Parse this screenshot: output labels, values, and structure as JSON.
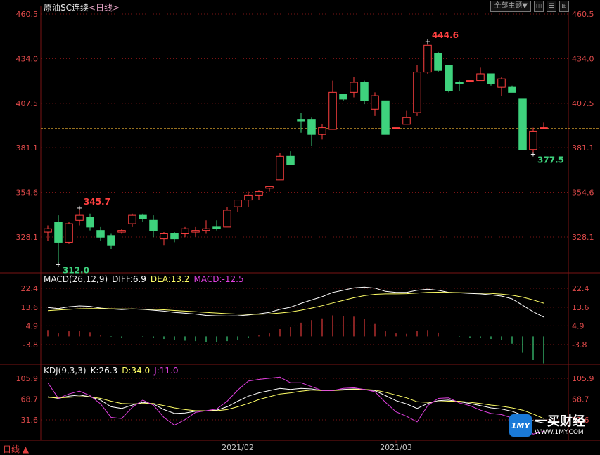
{
  "header": {
    "title": "原油SC连续",
    "period": "<日线>"
  },
  "toolbar": {
    "theme_label": "全部主题▼",
    "btn1": "◫",
    "btn2": "☰",
    "btn3": "⊞"
  },
  "period_tab": {
    "label": "日线",
    "arrow": "▲"
  },
  "watermark": {
    "logo": "1MY",
    "name": "一买财经",
    "url": "WWW.1MY.COM"
  },
  "colors": {
    "up": "#ff4040",
    "down": "#3ed27d",
    "grid": "#7a1414",
    "dashed": "#c8962a",
    "axis_text": "#e04a4a",
    "macd_pos": "#e03a3a",
    "macd_neg": "#3ed27d",
    "diff": "#ffffff",
    "dea": "#ffff66",
    "macd": "#e040e0",
    "k": "#ffffff",
    "d": "#ffff66",
    "j": "#e040e0"
  },
  "chart_data": [
    {
      "type": "candlestick",
      "title": "原油SC连续 日线",
      "y_ticks": [
        "460.5",
        "434.0",
        "407.5",
        "381.1",
        "354.6",
        "328.1"
      ],
      "ylim": [
        302,
        464
      ],
      "reference_line": 392.5,
      "x_labels": [
        "2021/02",
        "2021/03"
      ],
      "annotations": [
        {
          "text": "345.7",
          "value": 345.7,
          "kind": "high"
        },
        {
          "text": "312.0",
          "value": 312.0,
          "kind": "low"
        },
        {
          "text": "444.6",
          "value": 444.6,
          "kind": "high"
        },
        {
          "text": "377.5",
          "value": 377.5,
          "kind": "low"
        }
      ],
      "candles": [
        {
          "o": 331,
          "h": 335,
          "l": 326,
          "c": 333
        },
        {
          "o": 337,
          "h": 341,
          "l": 312,
          "c": 325
        },
        {
          "o": 325,
          "h": 337,
          "l": 324,
          "c": 336
        },
        {
          "o": 338,
          "h": 345.7,
          "l": 335,
          "c": 341
        },
        {
          "o": 340,
          "h": 342,
          "l": 332,
          "c": 334
        },
        {
          "o": 332,
          "h": 334,
          "l": 326,
          "c": 328
        },
        {
          "o": 329,
          "h": 330,
          "l": 321,
          "c": 323
        },
        {
          "o": 331,
          "h": 333,
          "l": 330,
          "c": 332
        },
        {
          "o": 336,
          "h": 342,
          "l": 334,
          "c": 341
        },
        {
          "o": 341,
          "h": 342,
          "l": 337,
          "c": 339
        },
        {
          "o": 338,
          "h": 341,
          "l": 328,
          "c": 332
        },
        {
          "o": 327,
          "h": 331,
          "l": 323,
          "c": 330
        },
        {
          "o": 330,
          "h": 331,
          "l": 325,
          "c": 327
        },
        {
          "o": 330,
          "h": 334,
          "l": 328,
          "c": 333
        },
        {
          "o": 331,
          "h": 334,
          "l": 328,
          "c": 332
        },
        {
          "o": 332,
          "h": 338,
          "l": 330,
          "c": 333
        },
        {
          "o": 334,
          "h": 338,
          "l": 332,
          "c": 333
        },
        {
          "o": 334,
          "h": 346,
          "l": 334,
          "c": 344
        },
        {
          "o": 346,
          "h": 350,
          "l": 343,
          "c": 350
        },
        {
          "o": 350,
          "h": 355,
          "l": 346,
          "c": 353
        },
        {
          "o": 353,
          "h": 356,
          "l": 350,
          "c": 355
        },
        {
          "o": 357,
          "h": 358,
          "l": 355,
          "c": 358
        },
        {
          "o": 362,
          "h": 378,
          "l": 362,
          "c": 376
        },
        {
          "o": 376,
          "h": 379,
          "l": 371,
          "c": 371
        },
        {
          "o": 398,
          "h": 402,
          "l": 390,
          "c": 397
        },
        {
          "o": 398,
          "h": 399,
          "l": 382,
          "c": 389
        },
        {
          "o": 389,
          "h": 395,
          "l": 386,
          "c": 393
        },
        {
          "o": 392,
          "h": 421,
          "l": 392,
          "c": 414
        },
        {
          "o": 413,
          "h": 413,
          "l": 409,
          "c": 410
        },
        {
          "o": 414,
          "h": 423,
          "l": 411,
          "c": 420
        },
        {
          "o": 420,
          "h": 421,
          "l": 407,
          "c": 409
        },
        {
          "o": 404,
          "h": 414,
          "l": 400,
          "c": 412
        },
        {
          "o": 409,
          "h": 409,
          "l": 389,
          "c": 389
        },
        {
          "o": 393,
          "h": 393,
          "l": 392,
          "c": 393
        },
        {
          "o": 395,
          "h": 403,
          "l": 395,
          "c": 399
        },
        {
          "o": 402,
          "h": 430,
          "l": 400,
          "c": 426
        },
        {
          "o": 426,
          "h": 444.6,
          "l": 425,
          "c": 442
        },
        {
          "o": 437,
          "h": 438,
          "l": 426,
          "c": 427
        },
        {
          "o": 430,
          "h": 430,
          "l": 414,
          "c": 415
        },
        {
          "o": 420,
          "h": 421,
          "l": 415,
          "c": 419
        },
        {
          "o": 421,
          "h": 421,
          "l": 420,
          "c": 421
        },
        {
          "o": 421,
          "h": 429,
          "l": 421,
          "c": 425
        },
        {
          "o": 425,
          "h": 425,
          "l": 418,
          "c": 419
        },
        {
          "o": 417,
          "h": 423,
          "l": 412,
          "c": 422
        },
        {
          "o": 417,
          "h": 418,
          "l": 414,
          "c": 414
        },
        {
          "o": 410,
          "h": 410,
          "l": 380,
          "c": 380
        },
        {
          "o": 380,
          "h": 393,
          "l": 377.5,
          "c": 391
        },
        {
          "o": 393,
          "h": 396,
          "l": 392,
          "c": 393
        }
      ]
    },
    {
      "type": "line",
      "title": "MACD(26,12,9)",
      "legend": [
        {
          "label": "DIFF:6.9"
        },
        {
          "label": "DEA:13.2"
        },
        {
          "label": "MACD:-12.5"
        }
      ],
      "y_ticks": [
        "22.4",
        "13.6",
        "4.9",
        "-3.8"
      ],
      "ylim": [
        -12,
        26
      ],
      "series": [
        {
          "name": "DIFF",
          "values": [
            13.5,
            13.0,
            13.8,
            14.2,
            14.0,
            13.2,
            12.8,
            12.5,
            12.8,
            12.6,
            12.2,
            11.8,
            11.2,
            10.8,
            10.4,
            9.8,
            9.6,
            9.5,
            9.6,
            10.0,
            10.5,
            11.2,
            12.6,
            13.6,
            15.4,
            17.0,
            18.5,
            20.5,
            21.5,
            22.6,
            23.0,
            22.5,
            21.0,
            20.5,
            20.5,
            21.5,
            22.0,
            21.5,
            20.5,
            20.3,
            20.0,
            19.8,
            19.4,
            18.8,
            17.5,
            14.5,
            11.5,
            9.0
          ]
        },
        {
          "name": "DEA",
          "values": [
            12.0,
            12.3,
            12.6,
            12.9,
            13.0,
            13.0,
            12.9,
            12.8,
            12.8,
            12.7,
            12.6,
            12.4,
            12.1,
            11.8,
            11.5,
            11.2,
            10.9,
            10.6,
            10.4,
            10.3,
            10.3,
            10.5,
            10.9,
            11.4,
            12.2,
            13.2,
            14.3,
            15.6,
            16.8,
            18.0,
            19.0,
            19.6,
            19.8,
            19.8,
            19.9,
            20.2,
            20.5,
            20.6,
            20.5,
            20.4,
            20.3,
            20.2,
            20.0,
            19.7,
            19.2,
            18.3,
            17.0,
            15.5
          ]
        },
        {
          "name": "MACD",
          "values": [
            3.0,
            1.4,
            2.4,
            2.6,
            2.0,
            0.4,
            -0.2,
            -0.6,
            0.0,
            -0.2,
            -0.8,
            -1.2,
            -1.8,
            -2.0,
            -2.2,
            -2.8,
            -2.6,
            -2.2,
            -1.6,
            -0.6,
            0.4,
            1.4,
            3.4,
            4.4,
            6.4,
            7.6,
            8.4,
            9.8,
            9.4,
            9.2,
            8.0,
            5.8,
            2.4,
            1.4,
            1.2,
            2.6,
            3.0,
            1.8,
            0.0,
            -0.2,
            -0.6,
            -0.8,
            -1.2,
            -1.8,
            -3.4,
            -7.6,
            -11.0,
            -12.5
          ]
        }
      ]
    },
    {
      "type": "line",
      "title": "KDJ(9,3,3)",
      "legend": [
        {
          "label": "K:26.3"
        },
        {
          "label": "D:34.0"
        },
        {
          "label": "J:11.0"
        }
      ],
      "y_ticks": [
        "105.9",
        "68.7",
        "31.6"
      ],
      "ylim": [
        0,
        122
      ],
      "series": [
        {
          "name": "K",
          "values": [
            73,
            70,
            74,
            76,
            73,
            67,
            55,
            52,
            58,
            63,
            60,
            50,
            43,
            44,
            47,
            48,
            49,
            55,
            65,
            74,
            80,
            84,
            88,
            86,
            88,
            87,
            84,
            84,
            86,
            87,
            86,
            84,
            75,
            66,
            60,
            52,
            61,
            66,
            67,
            64,
            61,
            57,
            53,
            51,
            47,
            40,
            30,
            26
          ]
        },
        {
          "name": "D",
          "values": [
            72,
            71,
            72,
            73,
            73,
            70,
            65,
            61,
            60,
            61,
            61,
            57,
            53,
            50,
            48,
            48,
            48,
            50,
            55,
            61,
            68,
            73,
            78,
            80,
            83,
            85,
            84,
            84,
            85,
            86,
            86,
            85,
            81,
            76,
            71,
            64,
            63,
            64,
            65,
            65,
            63,
            61,
            58,
            56,
            53,
            49,
            42,
            34
          ]
        },
        {
          "name": "J",
          "values": [
            98,
            70,
            78,
            83,
            75,
            60,
            36,
            34,
            54,
            67,
            58,
            36,
            22,
            32,
            45,
            48,
            51,
            65,
            85,
            101,
            104,
            106,
            108,
            98,
            98,
            91,
            84,
            84,
            88,
            89,
            86,
            82,
            63,
            46,
            38,
            28,
            57,
            70,
            71,
            62,
            57,
            49,
            43,
            41,
            35,
            22,
            6,
            11
          ]
        }
      ]
    }
  ]
}
